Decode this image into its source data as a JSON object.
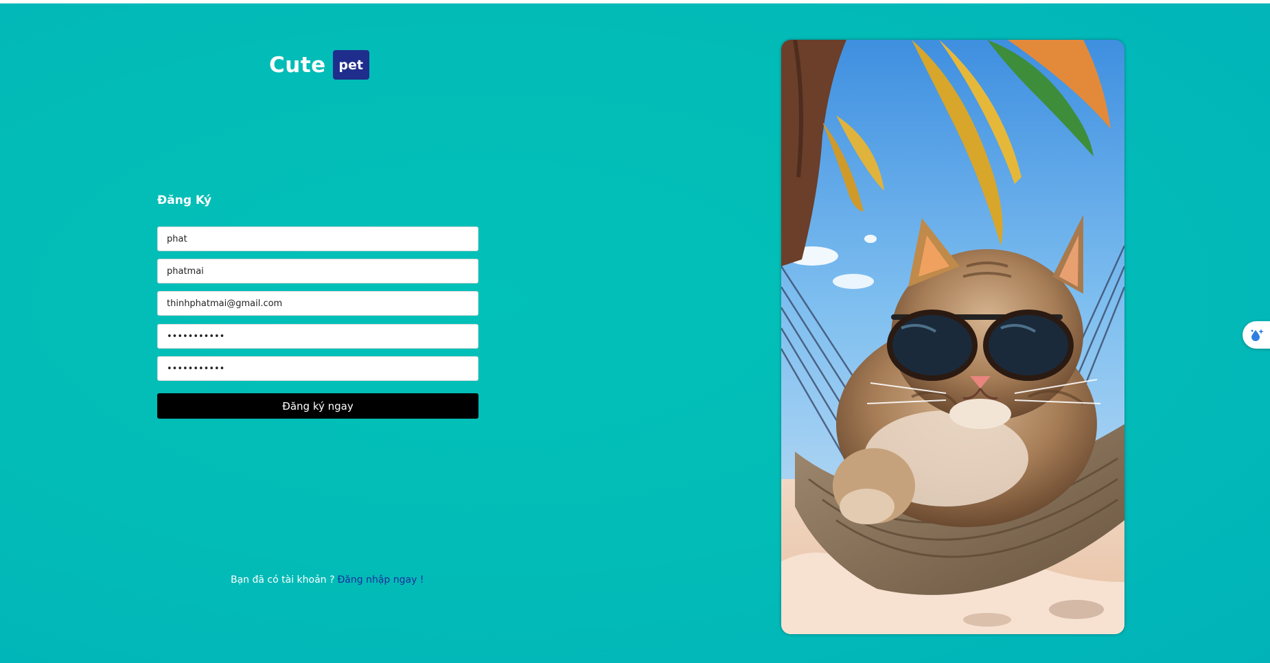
{
  "brand": {
    "name": "Cute",
    "badge": "pet"
  },
  "form": {
    "title": "Đăng Ký",
    "fields": [
      {
        "value": "phat",
        "type": "text"
      },
      {
        "value": "phatmai",
        "type": "text"
      },
      {
        "value": "thinhphatmai@gmail.com",
        "type": "text"
      },
      {
        "value": "•••••••••••",
        "type": "password"
      },
      {
        "value": "•••••••••••",
        "type": "password"
      }
    ],
    "submit_label": "Đăng ký ngay"
  },
  "footer": {
    "question": "Bạn đã có tài khoản ?",
    "login_link": "Đăng nhập ngay !"
  },
  "image": {
    "subject": "cat-in-sunglasses-on-hammock"
  },
  "widget": {
    "icon": "sparkle-drop-icon"
  },
  "colors": {
    "background": "#02bdb7",
    "brand_badge": "#1f2d8c",
    "button": "#000000",
    "link": "#1c2f9a"
  }
}
